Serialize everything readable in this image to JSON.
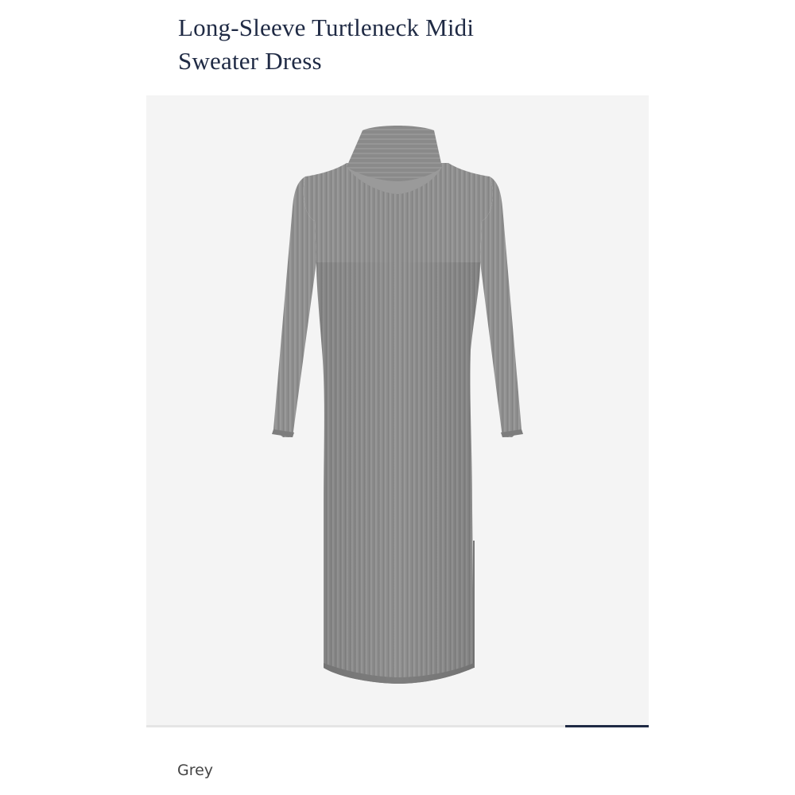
{
  "product": {
    "title_line1": "Long-Sleeve Turtleneck Midi",
    "title_line2": "Sweater Dress",
    "color_name": "Grey"
  },
  "gallery": {
    "image_name": "grey-turtleneck-sweater-dress-photo",
    "slide_progress": 1.0
  },
  "colors": {
    "title": "#1f2a44",
    "image_background": "#f4f4f4",
    "dress": "#8e8e8e",
    "indicator": "#1f2a44"
  }
}
